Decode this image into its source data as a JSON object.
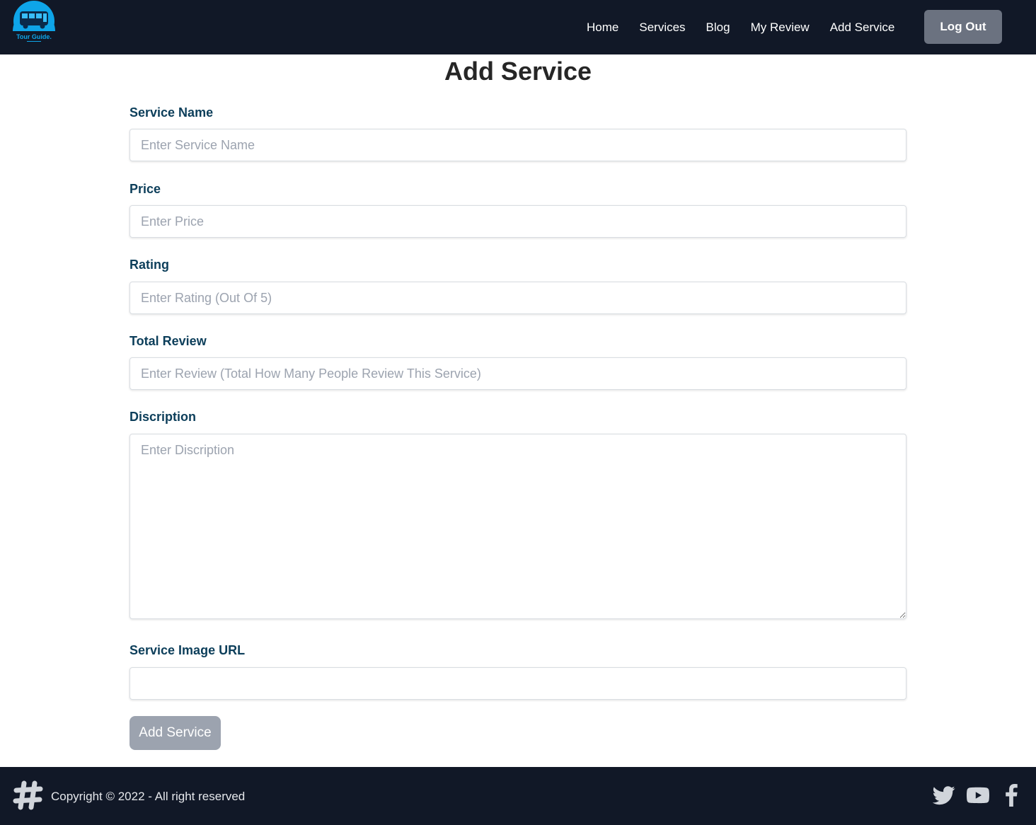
{
  "header": {
    "logo_icon": "tour-guide-bus-logo",
    "logo_text": "Tour Guide.",
    "nav": [
      {
        "label": "Home"
      },
      {
        "label": "Services"
      },
      {
        "label": "Blog"
      },
      {
        "label": "My Review"
      },
      {
        "label": "Add Service"
      }
    ],
    "logout_label": "Log Out"
  },
  "form": {
    "title": "Add Service",
    "fields": {
      "service_name": {
        "label": "Service Name",
        "placeholder": "Enter Service Name",
        "value": ""
      },
      "price": {
        "label": "Price",
        "placeholder": "Enter Price",
        "value": ""
      },
      "rating": {
        "label": "Rating",
        "placeholder": "Enter Rating (Out Of 5)",
        "value": ""
      },
      "total_review": {
        "label": "Total Review",
        "placeholder": "Enter Review (Total How Many People Review This Service)",
        "value": ""
      },
      "description": {
        "label": "Discription",
        "placeholder": "Enter Discription",
        "value": ""
      },
      "image_url": {
        "label": "Service Image URL",
        "placeholder": "",
        "value": ""
      }
    },
    "submit_label": "Add Service"
  },
  "footer": {
    "logo_icon": "hash-icon",
    "copyright": "Copyright © 2022 - All right reserved",
    "social": [
      "twitter-icon",
      "youtube-icon",
      "facebook-icon"
    ]
  },
  "colors": {
    "navbar_bg": "#111827",
    "label": "#0c3e5a",
    "logout_button": "#6b7280",
    "submit_button": "#9ca3af",
    "logo_accent": "#0ea5e9"
  }
}
